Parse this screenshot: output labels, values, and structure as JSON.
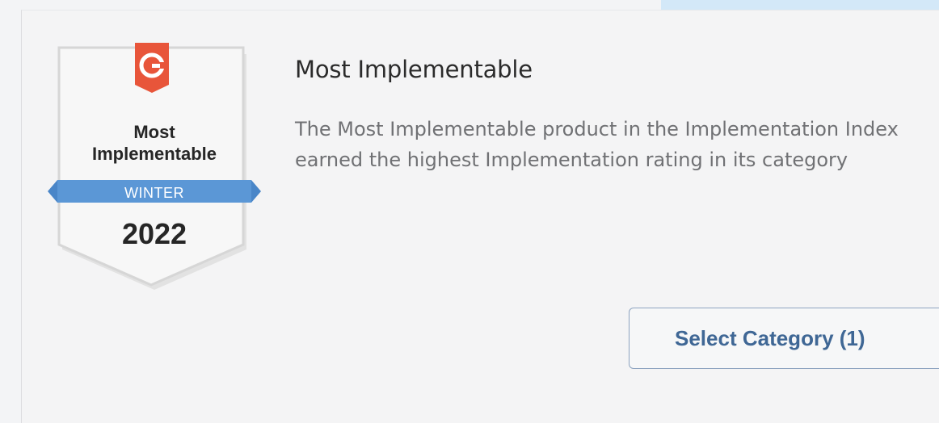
{
  "badge": {
    "logo_text": "G²",
    "line1": "Most",
    "line2": "Implementable",
    "season": "WINTER",
    "year": "2022",
    "colors": {
      "logo_red": "#e8553a",
      "ribbon_blue": "#4f8fd1",
      "shield_fill": "#f5f5f5",
      "shield_border": "#dcdcdc"
    }
  },
  "award": {
    "title": "Most Implementable",
    "description": "The Most Implementable product in the Implementation Index earned the highest Implementation rating in its category"
  },
  "actions": {
    "select_category_label": "Select Category (1)"
  }
}
